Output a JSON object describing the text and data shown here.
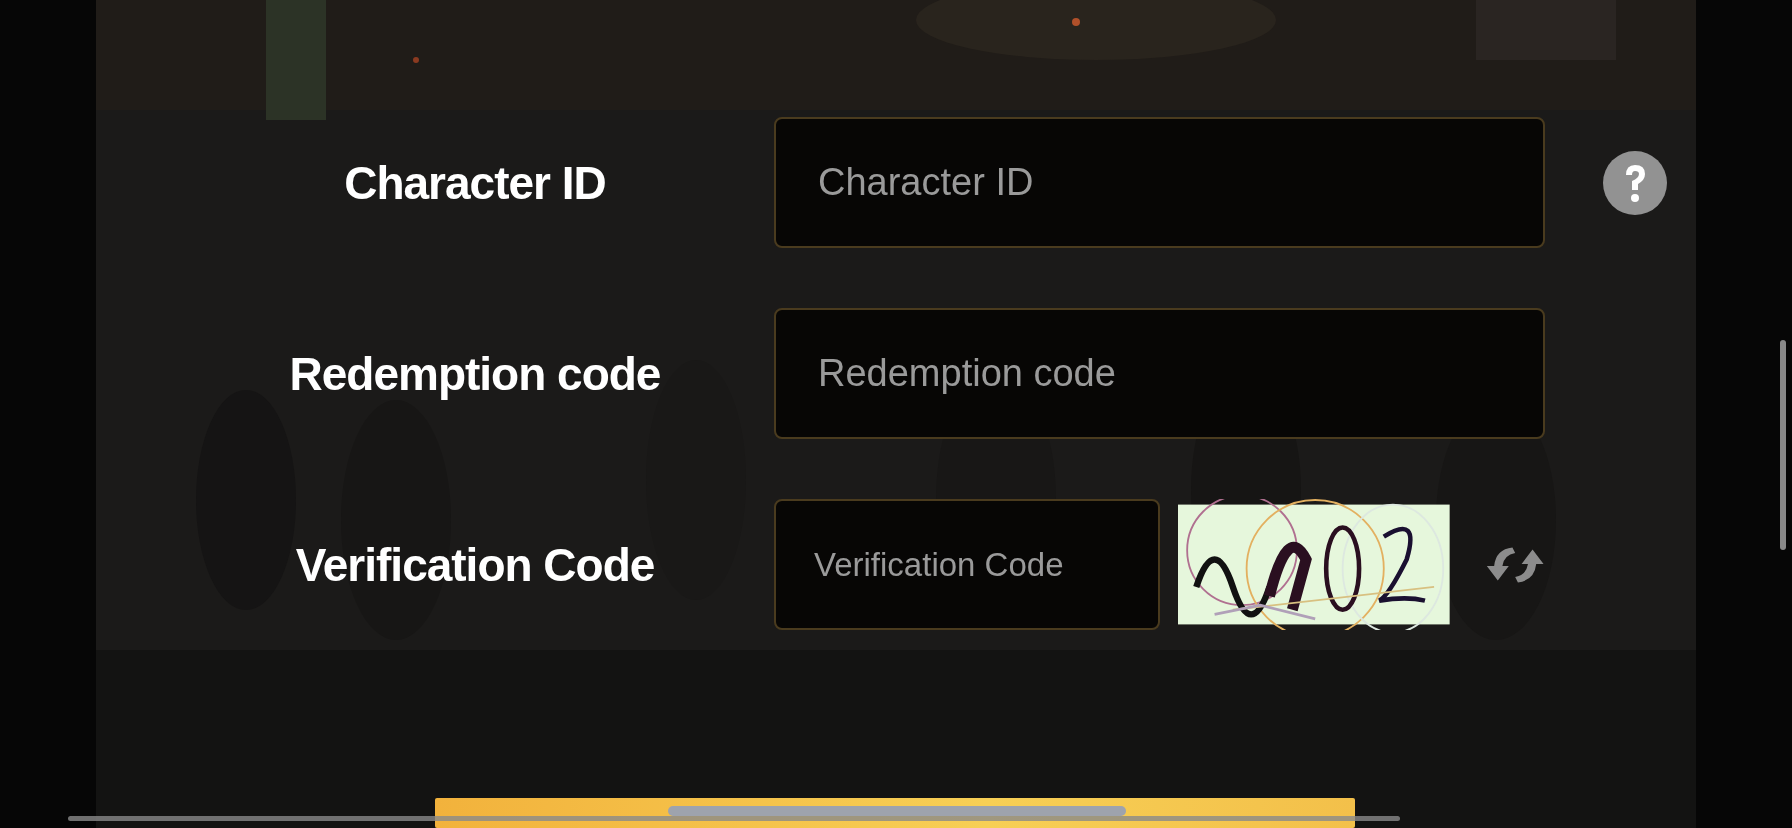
{
  "form": {
    "fields": [
      {
        "kind": "text",
        "label": "Character ID",
        "placeholder": "Character ID",
        "help": true
      },
      {
        "kind": "text",
        "label": "Redemption code",
        "placeholder": "Redemption code",
        "help": false
      },
      {
        "kind": "captcha",
        "label": "Verification Code",
        "placeholder": "Verification Code",
        "help": false
      }
    ]
  }
}
